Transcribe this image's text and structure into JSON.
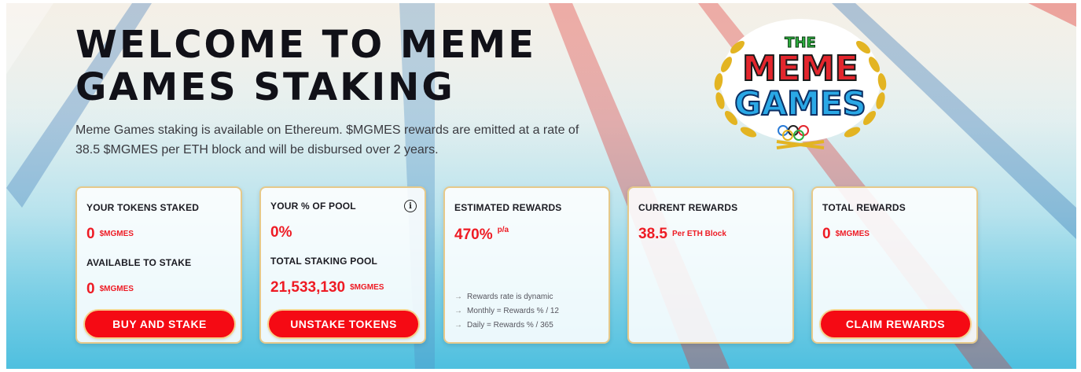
{
  "hero": {
    "title": "WELCOME TO MEME GAMES STAKING",
    "description": "Meme Games staking is available on Ethereum. $MGMES rewards are emitted at a rate of 38.5 $MGMES per ETH block and will be disbursed over 2 years."
  },
  "logo": {
    "line1": "THE",
    "line2": "MEME",
    "line3": "GAMES"
  },
  "cards": {
    "staked": {
      "label": "YOUR TOKENS STAKED",
      "value": "0",
      "unit": "$MGMES",
      "label2": "AVAILABLE TO STAKE",
      "value2": "0",
      "unit2": "$MGMES",
      "button": "BUY AND STAKE"
    },
    "pool": {
      "label": "YOUR % OF POOL",
      "value": "0%",
      "label2": "TOTAL STAKING POOL",
      "value2": "21,533,130",
      "unit2": "$MGMES",
      "button": "UNSTAKE TOKENS",
      "info_icon": "i"
    },
    "estimated": {
      "label": "ESTIMATED REWARDS",
      "value": "470%",
      "suffix": "p/a",
      "notes": [
        "Rewards rate is dynamic",
        "Monthly = Rewards % / 12",
        "Daily = Rewards % / 365"
      ],
      "note_arrow": "→"
    },
    "current": {
      "label": "CURRENT REWARDS",
      "value": "38.5",
      "unit": "Per ETH Block"
    },
    "total": {
      "label": "TOTAL REWARDS",
      "value": "0",
      "unit": "$MGMES",
      "button": "CLAIM REWARDS"
    }
  },
  "colors": {
    "accent": "#ee1b24",
    "button": "#f50a14",
    "card_border": "#e6c98a"
  }
}
